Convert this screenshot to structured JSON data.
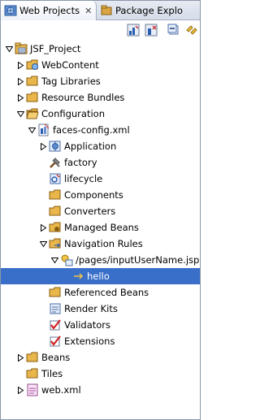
{
  "tabs": {
    "active_label": "Web Projects",
    "close_glyph": "✕",
    "inactive_label": "Package Explo"
  },
  "colors": {
    "selection": "#3a6fc9",
    "folder": "#e8b64a",
    "tab_bg": "#d5dce8"
  },
  "toolbar": {
    "icons": [
      "jsf-graph-icon",
      "jsf-config-icon",
      "collapse-all-icon",
      "link-with-editor-icon"
    ]
  },
  "tree": {
    "root": "JSF_Project",
    "web_content": "WebContent",
    "tag_libraries": "Tag Libraries",
    "resource_bundles": "Resource Bundles",
    "configuration": "Configuration",
    "faces_config": "faces-config.xml",
    "application": "Application",
    "factory": "factory",
    "lifecycle": "lifecycle",
    "components": "Components",
    "converters": "Converters",
    "managed_beans": "Managed Beans",
    "navigation_rules": "Navigation Rules",
    "nav_rule_path": "/pages/inputUserName.jsp",
    "hello": "hello",
    "referenced_beans": "Referenced Beans",
    "render_kits": "Render Kits",
    "validators": "Validators",
    "extensions": "Extensions",
    "beans": "Beans",
    "tiles": "Tiles",
    "web_xml": "web.xml"
  }
}
